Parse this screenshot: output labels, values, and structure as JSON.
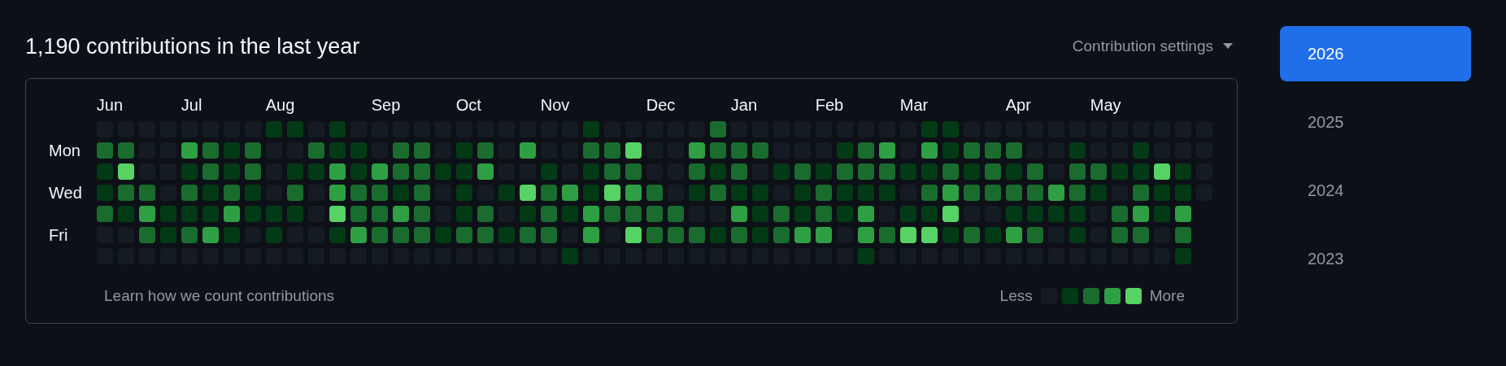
{
  "heading": "1,190 contributions in the last year",
  "settings": {
    "label": "Contribution settings"
  },
  "day_labels": [
    "Mon",
    "Wed",
    "Fri"
  ],
  "weeks": [
    {
      "month": "Jun",
      "days": [
        {
          "color": "#151b23"
        },
        {
          "color": "#196c2e"
        },
        {
          "color": "#033a16"
        },
        {
          "color": "#033a16"
        },
        {
          "color": "#196c2e"
        },
        {
          "color": "#151b23"
        },
        {
          "color": "#151b23"
        }
      ]
    },
    {
      "days": [
        {
          "color": "#151b23"
        },
        {
          "color": "#196c2e"
        },
        {
          "color": "#56d364"
        },
        {
          "color": "#196c2e"
        },
        {
          "color": "#033a16"
        },
        {
          "color": "#151b23"
        },
        {
          "color": "#151b23"
        }
      ]
    },
    {
      "days": [
        {
          "color": "#151b23"
        },
        {
          "color": "#151b23"
        },
        {
          "color": "#151b23"
        },
        {
          "color": "#196c2e"
        },
        {
          "color": "#2ea043"
        },
        {
          "color": "#196c2e"
        },
        {
          "color": "#151b23"
        }
      ]
    },
    {
      "days": [
        {
          "color": "#151b23"
        },
        {
          "color": "#151b23"
        },
        {
          "color": "#151b23"
        },
        {
          "color": "#151b23"
        },
        {
          "color": "#033a16"
        },
        {
          "color": "#033a16"
        },
        {
          "color": "#151b23"
        }
      ]
    },
    {
      "month": "Jul",
      "days": [
        {
          "color": "#151b23"
        },
        {
          "color": "#2ea043"
        },
        {
          "color": "#033a16"
        },
        {
          "color": "#196c2e"
        },
        {
          "color": "#033a16"
        },
        {
          "color": "#196c2e"
        },
        {
          "color": "#151b23"
        }
      ]
    },
    {
      "days": [
        {
          "color": "#151b23"
        },
        {
          "color": "#196c2e"
        },
        {
          "color": "#196c2e"
        },
        {
          "color": "#033a16"
        },
        {
          "color": "#033a16"
        },
        {
          "color": "#2ea043"
        },
        {
          "color": "#151b23"
        }
      ]
    },
    {
      "days": [
        {
          "color": "#151b23"
        },
        {
          "color": "#033a16"
        },
        {
          "color": "#033a16"
        },
        {
          "color": "#196c2e"
        },
        {
          "color": "#2ea043"
        },
        {
          "color": "#033a16"
        },
        {
          "color": "#151b23"
        }
      ]
    },
    {
      "days": [
        {
          "color": "#151b23"
        },
        {
          "color": "#196c2e"
        },
        {
          "color": "#196c2e"
        },
        {
          "color": "#033a16"
        },
        {
          "color": "#033a16"
        },
        {
          "color": "#151b23"
        },
        {
          "color": "#151b23"
        }
      ]
    },
    {
      "month": "Aug",
      "days": [
        {
          "color": "#033a16"
        },
        {
          "color": "#151b23"
        },
        {
          "color": "#151b23"
        },
        {
          "color": "#151b23"
        },
        {
          "color": "#033a16"
        },
        {
          "color": "#033a16"
        },
        {
          "color": "#151b23"
        }
      ]
    },
    {
      "days": [
        {
          "color": "#033a16"
        },
        {
          "color": "#151b23"
        },
        {
          "color": "#033a16"
        },
        {
          "color": "#196c2e"
        },
        {
          "color": "#033a16"
        },
        {
          "color": "#151b23"
        },
        {
          "color": "#151b23"
        }
      ]
    },
    {
      "days": [
        {
          "color": "#151b23"
        },
        {
          "color": "#196c2e"
        },
        {
          "color": "#033a16"
        },
        {
          "color": "#151b23"
        },
        {
          "color": "#151b23"
        },
        {
          "color": "#151b23"
        },
        {
          "color": "#151b23"
        }
      ]
    },
    {
      "days": [
        {
          "color": "#033a16"
        },
        {
          "color": "#033a16"
        },
        {
          "color": "#2ea043"
        },
        {
          "color": "#2ea043"
        },
        {
          "color": "#56d364"
        },
        {
          "color": "#033a16"
        },
        {
          "color": "#151b23"
        }
      ]
    },
    {
      "days": [
        {
          "color": "#151b23"
        },
        {
          "color": "#033a16"
        },
        {
          "color": "#033a16"
        },
        {
          "color": "#196c2e"
        },
        {
          "color": "#196c2e"
        },
        {
          "color": "#2ea043"
        },
        {
          "color": "#151b23"
        }
      ]
    },
    {
      "month": "Sep",
      "days": [
        {
          "color": "#151b23"
        },
        {
          "color": "#151b23"
        },
        {
          "color": "#2ea043"
        },
        {
          "color": "#196c2e"
        },
        {
          "color": "#196c2e"
        },
        {
          "color": "#196c2e"
        },
        {
          "color": "#151b23"
        }
      ]
    },
    {
      "days": [
        {
          "color": "#151b23"
        },
        {
          "color": "#196c2e"
        },
        {
          "color": "#196c2e"
        },
        {
          "color": "#033a16"
        },
        {
          "color": "#2ea043"
        },
        {
          "color": "#196c2e"
        },
        {
          "color": "#151b23"
        }
      ]
    },
    {
      "days": [
        {
          "color": "#151b23"
        },
        {
          "color": "#196c2e"
        },
        {
          "color": "#196c2e"
        },
        {
          "color": "#196c2e"
        },
        {
          "color": "#196c2e"
        },
        {
          "color": "#196c2e"
        },
        {
          "color": "#151b23"
        }
      ]
    },
    {
      "days": [
        {
          "color": "#151b23"
        },
        {
          "color": "#151b23"
        },
        {
          "color": "#033a16"
        },
        {
          "color": "#151b23"
        },
        {
          "color": "#151b23"
        },
        {
          "color": "#033a16"
        },
        {
          "color": "#151b23"
        }
      ]
    },
    {
      "month": "Oct",
      "days": [
        {
          "color": "#151b23"
        },
        {
          "color": "#033a16"
        },
        {
          "color": "#033a16"
        },
        {
          "color": "#033a16"
        },
        {
          "color": "#033a16"
        },
        {
          "color": "#196c2e"
        },
        {
          "color": "#151b23"
        }
      ]
    },
    {
      "days": [
        {
          "color": "#151b23"
        },
        {
          "color": "#196c2e"
        },
        {
          "color": "#2ea043"
        },
        {
          "color": "#151b23"
        },
        {
          "color": "#196c2e"
        },
        {
          "color": "#196c2e"
        },
        {
          "color": "#151b23"
        }
      ]
    },
    {
      "days": [
        {
          "color": "#151b23"
        },
        {
          "color": "#151b23"
        },
        {
          "color": "#151b23"
        },
        {
          "color": "#033a16"
        },
        {
          "color": "#151b23"
        },
        {
          "color": "#033a16"
        },
        {
          "color": "#151b23"
        }
      ]
    },
    {
      "days": [
        {
          "color": "#151b23"
        },
        {
          "color": "#2ea043"
        },
        {
          "color": "#151b23"
        },
        {
          "color": "#56d364"
        },
        {
          "color": "#033a16"
        },
        {
          "color": "#196c2e"
        },
        {
          "color": "#151b23"
        }
      ]
    },
    {
      "month": "Nov",
      "days": [
        {
          "color": "#151b23"
        },
        {
          "color": "#151b23"
        },
        {
          "color": "#033a16"
        },
        {
          "color": "#196c2e"
        },
        {
          "color": "#196c2e"
        },
        {
          "color": "#196c2e"
        },
        {
          "color": "#151b23"
        }
      ]
    },
    {
      "days": [
        {
          "color": "#151b23"
        },
        {
          "color": "#151b23"
        },
        {
          "color": "#151b23"
        },
        {
          "color": "#2ea043"
        },
        {
          "color": "#033a16"
        },
        {
          "color": "#151b23"
        },
        {
          "color": "#033a16"
        }
      ]
    },
    {
      "days": [
        {
          "color": "#033a16"
        },
        {
          "color": "#196c2e"
        },
        {
          "color": "#033a16"
        },
        {
          "color": "#033a16"
        },
        {
          "color": "#2ea043"
        },
        {
          "color": "#2ea043"
        },
        {
          "color": "#151b23"
        }
      ]
    },
    {
      "days": [
        {
          "color": "#151b23"
        },
        {
          "color": "#196c2e"
        },
        {
          "color": "#196c2e"
        },
        {
          "color": "#56d364"
        },
        {
          "color": "#196c2e"
        },
        {
          "color": "#151b23"
        },
        {
          "color": "#151b23"
        }
      ]
    },
    {
      "days": [
        {
          "color": "#151b23"
        },
        {
          "color": "#56d364"
        },
        {
          "color": "#196c2e"
        },
        {
          "color": "#2ea043"
        },
        {
          "color": "#196c2e"
        },
        {
          "color": "#56d364"
        },
        {
          "color": "#151b23"
        }
      ]
    },
    {
      "month": "Dec",
      "days": [
        {
          "color": "#151b23"
        },
        {
          "color": "#151b23"
        },
        {
          "color": "#151b23"
        },
        {
          "color": "#196c2e"
        },
        {
          "color": "#196c2e"
        },
        {
          "color": "#196c2e"
        },
        {
          "color": "#151b23"
        }
      ]
    },
    {
      "days": [
        {
          "color": "#151b23"
        },
        {
          "color": "#151b23"
        },
        {
          "color": "#151b23"
        },
        {
          "color": "#151b23"
        },
        {
          "color": "#196c2e"
        },
        {
          "color": "#196c2e"
        },
        {
          "color": "#151b23"
        }
      ]
    },
    {
      "days": [
        {
          "color": "#151b23"
        },
        {
          "color": "#2ea043"
        },
        {
          "color": "#196c2e"
        },
        {
          "color": "#033a16"
        },
        {
          "color": "#151b23"
        },
        {
          "color": "#196c2e"
        },
        {
          "color": "#151b23"
        }
      ]
    },
    {
      "days": [
        {
          "color": "#196c2e"
        },
        {
          "color": "#196c2e"
        },
        {
          "color": "#033a16"
        },
        {
          "color": "#196c2e"
        },
        {
          "color": "#151b23"
        },
        {
          "color": "#033a16"
        },
        {
          "color": "#151b23"
        }
      ]
    },
    {
      "month": "Jan",
      "days": [
        {
          "color": "#151b23"
        },
        {
          "color": "#196c2e"
        },
        {
          "color": "#196c2e"
        },
        {
          "color": "#033a16"
        },
        {
          "color": "#2ea043"
        },
        {
          "color": "#196c2e"
        },
        {
          "color": "#151b23"
        }
      ]
    },
    {
      "days": [
        {
          "color": "#151b23"
        },
        {
          "color": "#196c2e"
        },
        {
          "color": "#151b23"
        },
        {
          "color": "#033a16"
        },
        {
          "color": "#033a16"
        },
        {
          "color": "#033a16"
        },
        {
          "color": "#151b23"
        }
      ]
    },
    {
      "days": [
        {
          "color": "#151b23"
        },
        {
          "color": "#151b23"
        },
        {
          "color": "#033a16"
        },
        {
          "color": "#151b23"
        },
        {
          "color": "#196c2e"
        },
        {
          "color": "#196c2e"
        },
        {
          "color": "#151b23"
        }
      ]
    },
    {
      "days": [
        {
          "color": "#151b23"
        },
        {
          "color": "#151b23"
        },
        {
          "color": "#196c2e"
        },
        {
          "color": "#033a16"
        },
        {
          "color": "#033a16"
        },
        {
          "color": "#2ea043"
        },
        {
          "color": "#151b23"
        }
      ]
    },
    {
      "month": "Feb",
      "days": [
        {
          "color": "#151b23"
        },
        {
          "color": "#151b23"
        },
        {
          "color": "#033a16"
        },
        {
          "color": "#196c2e"
        },
        {
          "color": "#196c2e"
        },
        {
          "color": "#2ea043"
        },
        {
          "color": "#151b23"
        }
      ]
    },
    {
      "days": [
        {
          "color": "#151b23"
        },
        {
          "color": "#033a16"
        },
        {
          "color": "#196c2e"
        },
        {
          "color": "#033a16"
        },
        {
          "color": "#033a16"
        },
        {
          "color": "#151b23"
        },
        {
          "color": "#151b23"
        }
      ]
    },
    {
      "days": [
        {
          "color": "#151b23"
        },
        {
          "color": "#196c2e"
        },
        {
          "color": "#196c2e"
        },
        {
          "color": "#033a16"
        },
        {
          "color": "#2ea043"
        },
        {
          "color": "#2ea043"
        },
        {
          "color": "#033a16"
        }
      ]
    },
    {
      "days": [
        {
          "color": "#151b23"
        },
        {
          "color": "#2ea043"
        },
        {
          "color": "#196c2e"
        },
        {
          "color": "#033a16"
        },
        {
          "color": "#151b23"
        },
        {
          "color": "#196c2e"
        },
        {
          "color": "#151b23"
        }
      ]
    },
    {
      "month": "Mar",
      "days": [
        {
          "color": "#151b23"
        },
        {
          "color": "#151b23"
        },
        {
          "color": "#033a16"
        },
        {
          "color": "#151b23"
        },
        {
          "color": "#033a16"
        },
        {
          "color": "#56d364"
        },
        {
          "color": "#151b23"
        }
      ]
    },
    {
      "days": [
        {
          "color": "#033a16"
        },
        {
          "color": "#2ea043"
        },
        {
          "color": "#033a16"
        },
        {
          "color": "#196c2e"
        },
        {
          "color": "#033a16"
        },
        {
          "color": "#56d364"
        },
        {
          "color": "#151b23"
        }
      ]
    },
    {
      "days": [
        {
          "color": "#033a16"
        },
        {
          "color": "#033a16"
        },
        {
          "color": "#196c2e"
        },
        {
          "color": "#2ea043"
        },
        {
          "color": "#56d364"
        },
        {
          "color": "#033a16"
        },
        {
          "color": "#151b23"
        }
      ]
    },
    {
      "days": [
        {
          "color": "#151b23"
        },
        {
          "color": "#196c2e"
        },
        {
          "color": "#033a16"
        },
        {
          "color": "#196c2e"
        },
        {
          "color": "#151b23"
        },
        {
          "color": "#196c2e"
        },
        {
          "color": "#151b23"
        }
      ]
    },
    {
      "days": [
        {
          "color": "#151b23"
        },
        {
          "color": "#196c2e"
        },
        {
          "color": "#196c2e"
        },
        {
          "color": "#196c2e"
        },
        {
          "color": "#151b23"
        },
        {
          "color": "#033a16"
        },
        {
          "color": "#151b23"
        }
      ]
    },
    {
      "month": "Apr",
      "days": [
        {
          "color": "#151b23"
        },
        {
          "color": "#196c2e"
        },
        {
          "color": "#033a16"
        },
        {
          "color": "#196c2e"
        },
        {
          "color": "#033a16"
        },
        {
          "color": "#2ea043"
        },
        {
          "color": "#151b23"
        }
      ]
    },
    {
      "days": [
        {
          "color": "#151b23"
        },
        {
          "color": "#151b23"
        },
        {
          "color": "#196c2e"
        },
        {
          "color": "#196c2e"
        },
        {
          "color": "#033a16"
        },
        {
          "color": "#196c2e"
        },
        {
          "color": "#151b23"
        }
      ]
    },
    {
      "days": [
        {
          "color": "#151b23"
        },
        {
          "color": "#151b23"
        },
        {
          "color": "#151b23"
        },
        {
          "color": "#2ea043"
        },
        {
          "color": "#033a16"
        },
        {
          "color": "#151b23"
        },
        {
          "color": "#151b23"
        }
      ]
    },
    {
      "days": [
        {
          "color": "#151b23"
        },
        {
          "color": "#033a16"
        },
        {
          "color": "#196c2e"
        },
        {
          "color": "#196c2e"
        },
        {
          "color": "#033a16"
        },
        {
          "color": "#033a16"
        },
        {
          "color": "#151b23"
        }
      ]
    },
    {
      "month": "May",
      "days": [
        {
          "color": "#151b23"
        },
        {
          "color": "#151b23"
        },
        {
          "color": "#196c2e"
        },
        {
          "color": "#033a16"
        },
        {
          "color": "#151b23"
        },
        {
          "color": "#151b23"
        },
        {
          "color": "#151b23"
        }
      ]
    },
    {
      "days": [
        {
          "color": "#151b23"
        },
        {
          "color": "#151b23"
        },
        {
          "color": "#033a16"
        },
        {
          "color": "#151b23"
        },
        {
          "color": "#196c2e"
        },
        {
          "color": "#196c2e"
        },
        {
          "color": "#151b23"
        }
      ]
    },
    {
      "days": [
        {
          "color": "#151b23"
        },
        {
          "color": "#033a16"
        },
        {
          "color": "#033a16"
        },
        {
          "color": "#196c2e"
        },
        {
          "color": "#2ea043"
        },
        {
          "color": "#196c2e"
        },
        {
          "color": "#151b23"
        }
      ]
    },
    {
      "days": [
        {
          "color": "#151b23"
        },
        {
          "color": "#151b23"
        },
        {
          "color": "#56d364"
        },
        {
          "color": "#033a16"
        },
        {
          "color": "#033a16"
        },
        {
          "color": "#151b23"
        },
        {
          "color": "#151b23"
        }
      ]
    },
    {
      "days": [
        {
          "color": "#151b23"
        },
        {
          "color": "#151b23"
        },
        {
          "color": "#033a16"
        },
        {
          "color": "#033a16"
        },
        {
          "color": "#2ea043"
        },
        {
          "color": "#196c2e"
        },
        {
          "color": "#033a16"
        }
      ]
    },
    {
      "days": [
        {
          "color": "#151b23"
        },
        {
          "color": "#151b23"
        },
        {
          "color": "#151b23"
        },
        {
          "color": "#151b23"
        }
      ]
    }
  ],
  "learn_link": "Learn how we count contributions",
  "legend": {
    "less": "Less",
    "more": "More",
    "swatches": [
      {
        "color": "#151b23"
      },
      {
        "color": "#033a16"
      },
      {
        "color": "#196c2e"
      },
      {
        "color": "#2ea043"
      },
      {
        "color": "#56d364"
      }
    ]
  },
  "years": [
    {
      "label": "2026",
      "selected": true
    },
    {
      "label": "2025",
      "selected": false
    },
    {
      "label": "2024",
      "selected": false
    },
    {
      "label": "2023",
      "selected": false
    }
  ]
}
